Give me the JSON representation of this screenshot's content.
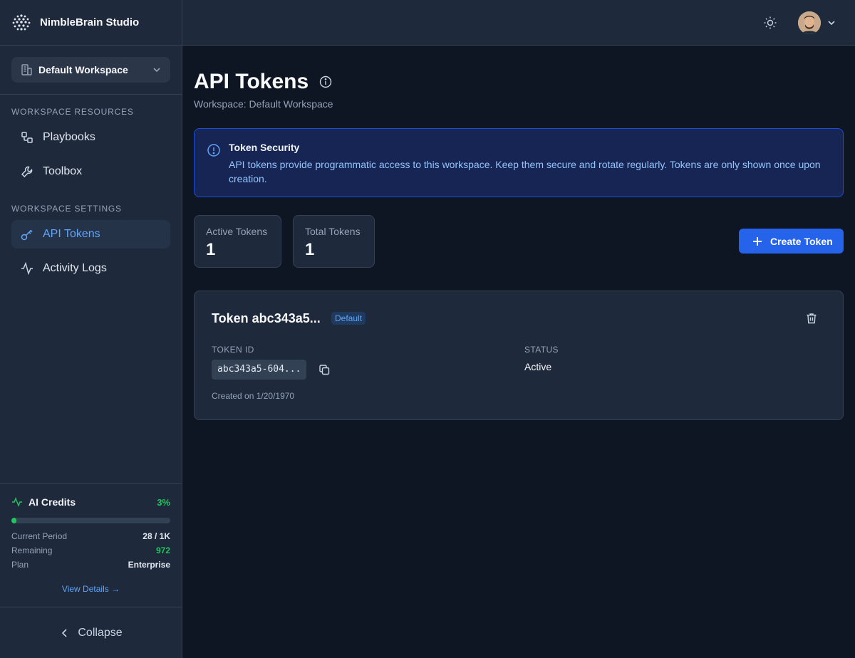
{
  "app": {
    "name": "NimbleBrain Studio"
  },
  "workspace_selector": {
    "label": "Default Workspace"
  },
  "sidebar": {
    "sections": [
      {
        "title": "WORKSPACE RESOURCES",
        "items": [
          {
            "label": "Playbooks",
            "icon": "workflow-icon"
          },
          {
            "label": "Toolbox",
            "icon": "wrench-icon"
          }
        ]
      },
      {
        "title": "WORKSPACE SETTINGS",
        "items": [
          {
            "label": "API Tokens",
            "icon": "key-icon",
            "active": true
          },
          {
            "label": "Activity Logs",
            "icon": "activity-icon"
          }
        ]
      }
    ],
    "credits": {
      "title": "AI Credits",
      "percent_label": "3%",
      "percent": 0.03,
      "rows": [
        {
          "label": "Current Period",
          "value": "28 / 1K"
        },
        {
          "label": "Remaining",
          "value": "972"
        },
        {
          "label": "Plan",
          "value": "Enterprise"
        }
      ],
      "view_details": "View Details →"
    },
    "collapse_label": "Collapse"
  },
  "page": {
    "title": "API Tokens",
    "subtitle": "Workspace: Default Workspace",
    "alert": {
      "title": "Token Security",
      "body": "API tokens provide programmatic access to this workspace. Keep them secure and rotate regularly. Tokens are only shown once upon creation."
    },
    "stats": [
      {
        "label": "Active Tokens",
        "value": "1"
      },
      {
        "label": "Total Tokens",
        "value": "1"
      }
    ],
    "create_button": "Create Token",
    "token": {
      "name": "Token abc343a5...",
      "badge": "Default",
      "id_label": "TOKEN ID",
      "id_value": "abc343a5-604...",
      "status_label": "STATUS",
      "status_value": "Active",
      "created": "Created on 1/20/1970"
    }
  },
  "colors": {
    "accent": "#2563eb",
    "link": "#60a5fa",
    "success": "#22c55e",
    "background": "#0f1623",
    "panel": "#1e293b"
  }
}
